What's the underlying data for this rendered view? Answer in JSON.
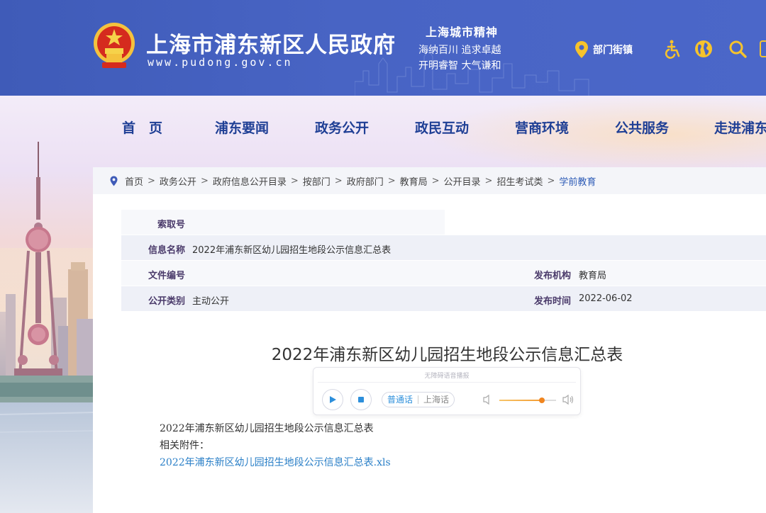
{
  "header": {
    "site_title": "上海市浦东新区人民政府",
    "site_url": "www.pudong.gov.cn",
    "spirit_title": "上海城市精神",
    "spirit_line_1": "海纳百川  追求卓越",
    "spirit_line_2": "开明睿智  大气谦和",
    "dept_link": "部门街镇",
    "icons": [
      "location-pin-icon",
      "accessibility-icon",
      "globe-icon",
      "search-icon"
    ]
  },
  "nav": {
    "items": [
      "首　页",
      "浦东要闻",
      "政务公开",
      "政民互动",
      "营商环境",
      "公共服务",
      "走进浦东"
    ]
  },
  "breadcrumb": {
    "items": [
      "首页",
      "政务公开",
      "政府信息公开目录",
      "按部门",
      "政府部门",
      "教育局",
      "公开目录",
      "招生考试类"
    ],
    "separator": ">",
    "current": "学前教育"
  },
  "meta": {
    "index_label": "索取号",
    "index_value": "",
    "name_label": "信息名称",
    "name_value": "2022年浦东新区幼儿园招生地段公示信息汇总表",
    "file_no_label": "文件编号",
    "file_no_value": "",
    "publisher_label": "发布机构",
    "publisher_value": "教育局",
    "category_label": "公开类别",
    "category_value": "主动公开",
    "date_label": "发布时间",
    "date_value": "2022-06-02"
  },
  "document": {
    "title": "2022年浦东新区幼儿园招生地段公示信息汇总表",
    "body_line": "2022年浦东新区幼儿园招生地段公示信息汇总表",
    "attachments_label": "相关附件：",
    "attachment_link": "2022年浦东新区幼儿园招生地段公示信息汇总表.xls"
  },
  "player": {
    "note": "无障碍语音播报",
    "lang_mandarin": "普通话",
    "lang_shanghainese": "上海话",
    "volume": 0.75
  },
  "colors": {
    "header_blue": "#4864c4",
    "nav_text": "#1f3f95",
    "link": "#2a7fc7",
    "accent_orange": "#f0851f"
  }
}
